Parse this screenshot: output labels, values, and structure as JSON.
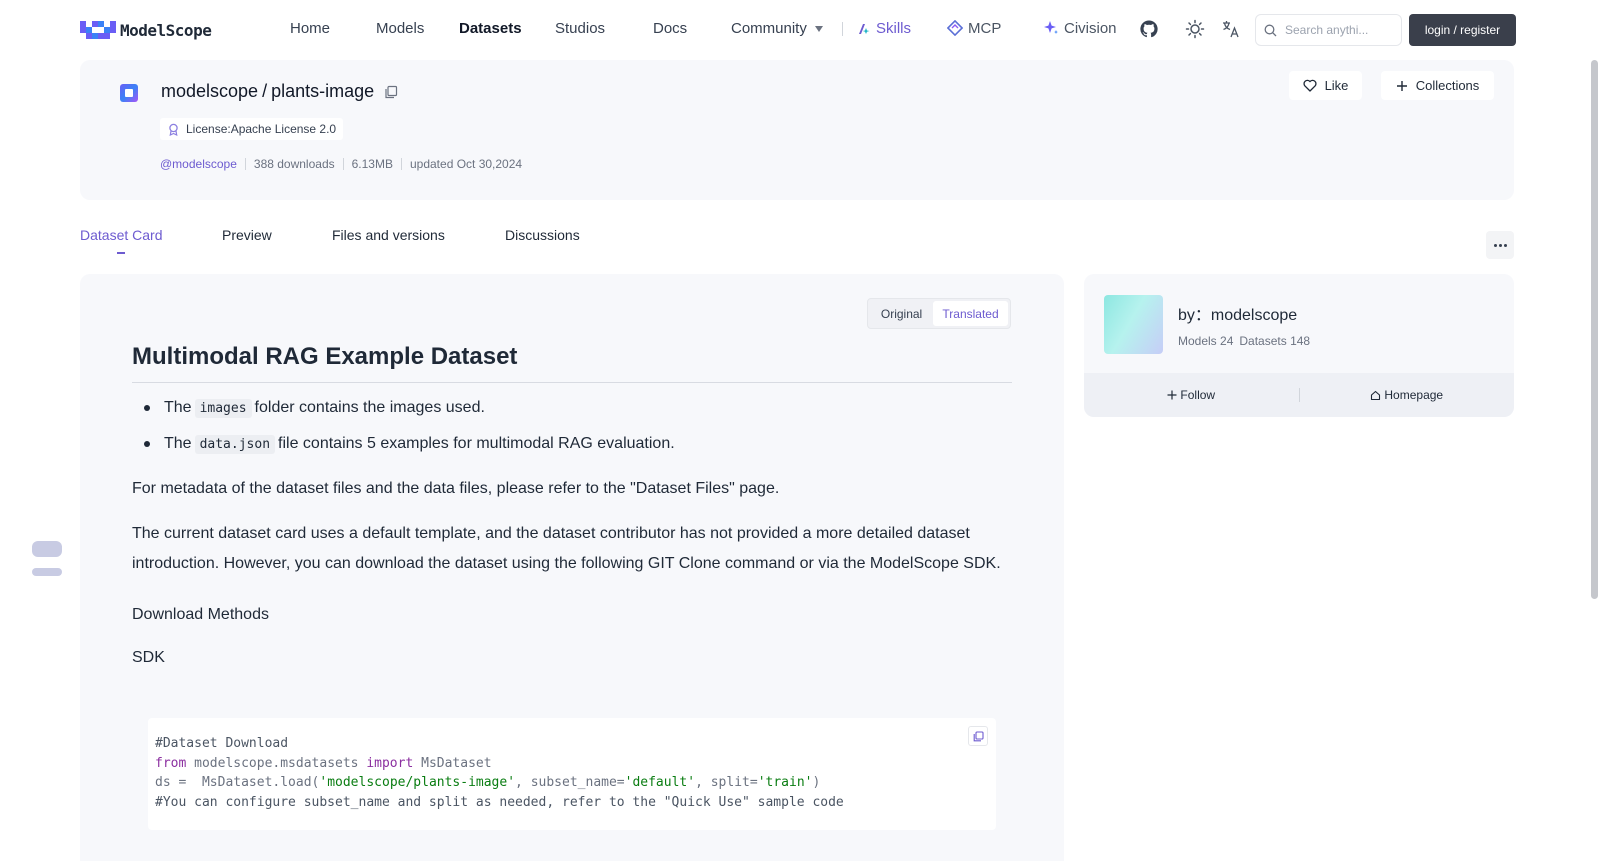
{
  "header": {
    "logo_text": "ModelScope",
    "nav": {
      "home": "Home",
      "models": "Models",
      "datasets": "Datasets",
      "studios": "Studios",
      "docs": "Docs",
      "community": "Community",
      "skills": "Skills",
      "mcp": "MCP",
      "civision": "Civision"
    },
    "search_placeholder": "Search anythi...",
    "login": "login / register",
    "accent_color": "#6d5bd0"
  },
  "dataset": {
    "owner": "modelscope",
    "slash": "/",
    "name": "plants-image",
    "license": "License:Apache License 2.0",
    "author": "@modelscope",
    "downloads": "388 downloads",
    "size": "6.13MB",
    "updated": "updated Oct 30,2024",
    "like": "Like",
    "collections": "Collections"
  },
  "tabs": {
    "card": "Dataset Card",
    "preview": "Preview",
    "files": "Files and versions",
    "discussions": "Discussions"
  },
  "content": {
    "toggle_original": "Original",
    "toggle_translated": "Translated",
    "title": "Multimodal RAG Example Dataset",
    "bullets": [
      {
        "pre": "The",
        "code": "images",
        "post": "folder contains the images used."
      },
      {
        "pre": "The",
        "code": "data.json",
        "post": "file contains 5 examples for multimodal RAG evaluation."
      }
    ],
    "p1": "For metadata of the dataset files and the data files, please refer to the \"Dataset Files\" page.",
    "p2": "The current dataset card uses a default template, and the dataset contributor has not provided a more detailed dataset introduction. However, you can download the dataset using the following GIT Clone command or via the ModelScope SDK.",
    "p3": "Download Methods",
    "p4": "SDK",
    "code": {
      "l1": "#Dataset Download",
      "l2_kw1": "from",
      "l2_mod": " modelscope.msdatasets ",
      "l2_kw2": "import",
      "l2_cls": " MsDataset",
      "l3_a": "ds =  MsDataset.load(",
      "l3_s1": "'modelscope/plants-image'",
      "l3_b": ", subset_name=",
      "l3_s2": "'default'",
      "l3_c": ", split=",
      "l3_s3": "'train'",
      "l3_d": ")",
      "l4": "#You can configure subset_name and split as needed, refer to the \"Quick Use\" sample code"
    }
  },
  "sidebar": {
    "by": "by：modelscope",
    "models": "Models 24",
    "datasets": "Datasets 148",
    "follow": "Follow",
    "homepage": "Homepage"
  },
  "icons": [
    "skills-icon",
    "mcp-icon",
    "sparkle-icon",
    "github-icon",
    "theme-icon",
    "language-icon",
    "search-icon",
    "copy-icon",
    "license-icon",
    "heart-icon",
    "plus-icon",
    "more-icon",
    "home-icon"
  ]
}
